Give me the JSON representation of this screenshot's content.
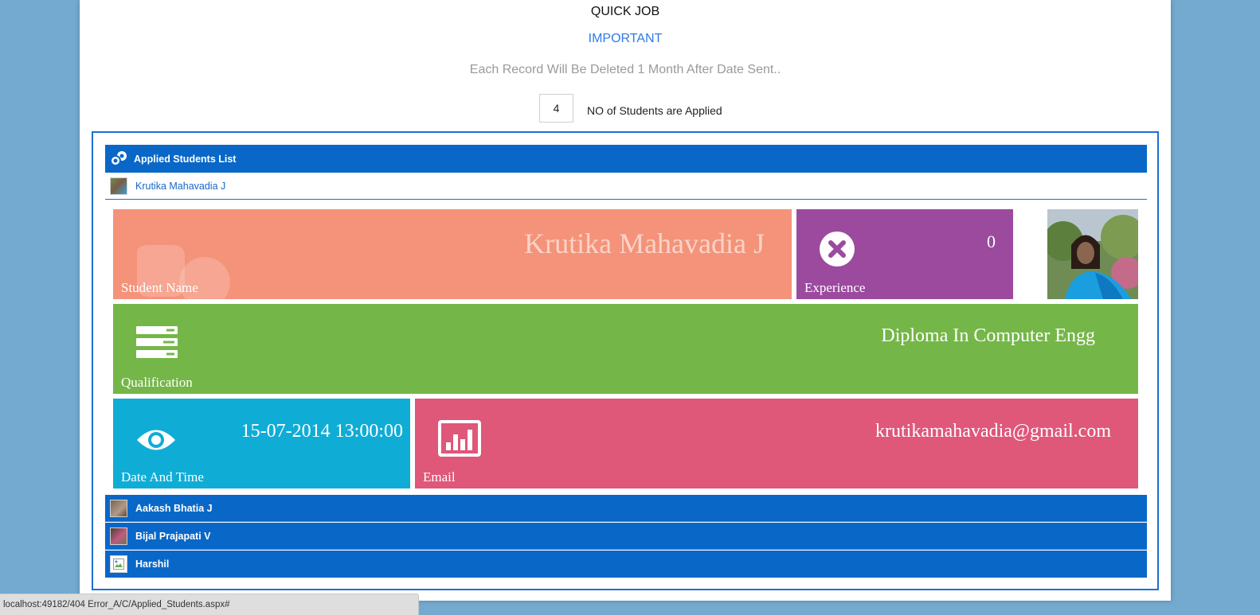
{
  "header": {
    "title": "QUICK JOB",
    "important": "IMPORTANT",
    "notice": "Each Record Will Be Deleted 1 Month After Date Sent..",
    "applied_count": "4",
    "applied_label": "NO of Students are Applied"
  },
  "list": {
    "header_label": "Applied Students List",
    "header_icon": "users-icon",
    "selected_student": "Krutika Mahavadia J",
    "other_students": [
      "Aakash Bhatia J",
      "Bijal Prajapati V",
      "Harshil"
    ]
  },
  "details": {
    "student_name_label": "Student Name",
    "student_name": "Krutika Mahavadia J",
    "experience_label": "Experience",
    "experience": "0",
    "qualification_label": "Qualification",
    "qualification": "Diploma In Computer Engg",
    "datetime_label": "Date And Time",
    "datetime": "15-07-2014 13:00:00",
    "email_label": "Email",
    "email": "krutikamahavadia@gmail.com"
  },
  "colors": {
    "name_tile": "#f4937a",
    "experience_tile": "#9b4a9e",
    "qualification_tile": "#74b748",
    "datetime_tile": "#0fadd6",
    "email_tile": "#df5779",
    "list_blue": "#0967c8"
  },
  "status_bar": {
    "url": "localhost:49182/404 Error_A/C/Applied_Students.aspx#"
  }
}
